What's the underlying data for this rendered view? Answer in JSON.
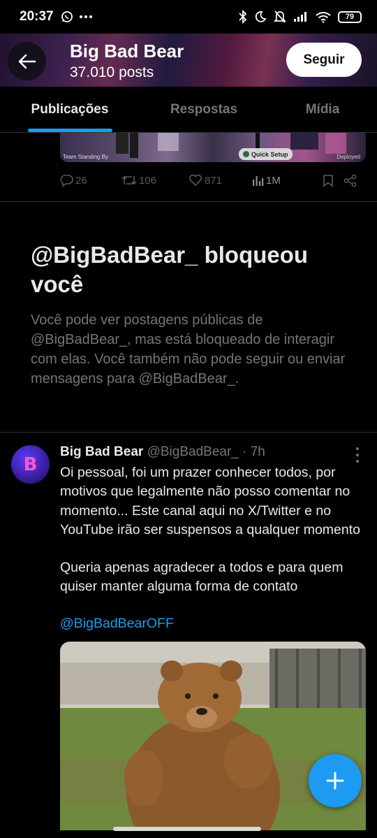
{
  "status_bar": {
    "time": "20:37",
    "battery": "79"
  },
  "header": {
    "title": "Big Bad Bear",
    "posts_count": "37.010 posts",
    "follow_label": "Seguir"
  },
  "tabs": [
    {
      "label": "Publicações",
      "active": true
    },
    {
      "label": "Respostas",
      "active": false
    },
    {
      "label": "Mídia",
      "active": false
    }
  ],
  "previous_post": {
    "media_caption": "Team Standing By",
    "media_badge": "Quick Setup",
    "media_status": "Deployed",
    "replies": "26",
    "reposts": "106",
    "likes": "871",
    "views": "1M"
  },
  "blocked_notice": {
    "title": "@BigBadBear_ bloqueou você",
    "description": "Você pode ver postagens públicas de @BigBadBear_, mas está bloqueado de interagir com elas. Você também não pode seguir ou enviar mensagens para @BigBadBear_."
  },
  "tweet": {
    "name": "Big Bad Bear",
    "handle_time": "@BigBadBear_ · 7h",
    "text_part1": "Oi pessoal, foi um prazer conhecer todos, por motivos que legalmente não posso comentar no momento... Este canal aqui no X/Twitter e no YouTube irão ser suspensos a qualquer momento",
    "text_part2": "Queria apenas agradecer a todos e para quem quiser manter alguma forma de contato",
    "mention": "@BigBadBearOFF",
    "avatar_letter": "B"
  },
  "colors": {
    "accent": "#1d9bf0",
    "background": "#000000",
    "muted": "#71767b"
  }
}
